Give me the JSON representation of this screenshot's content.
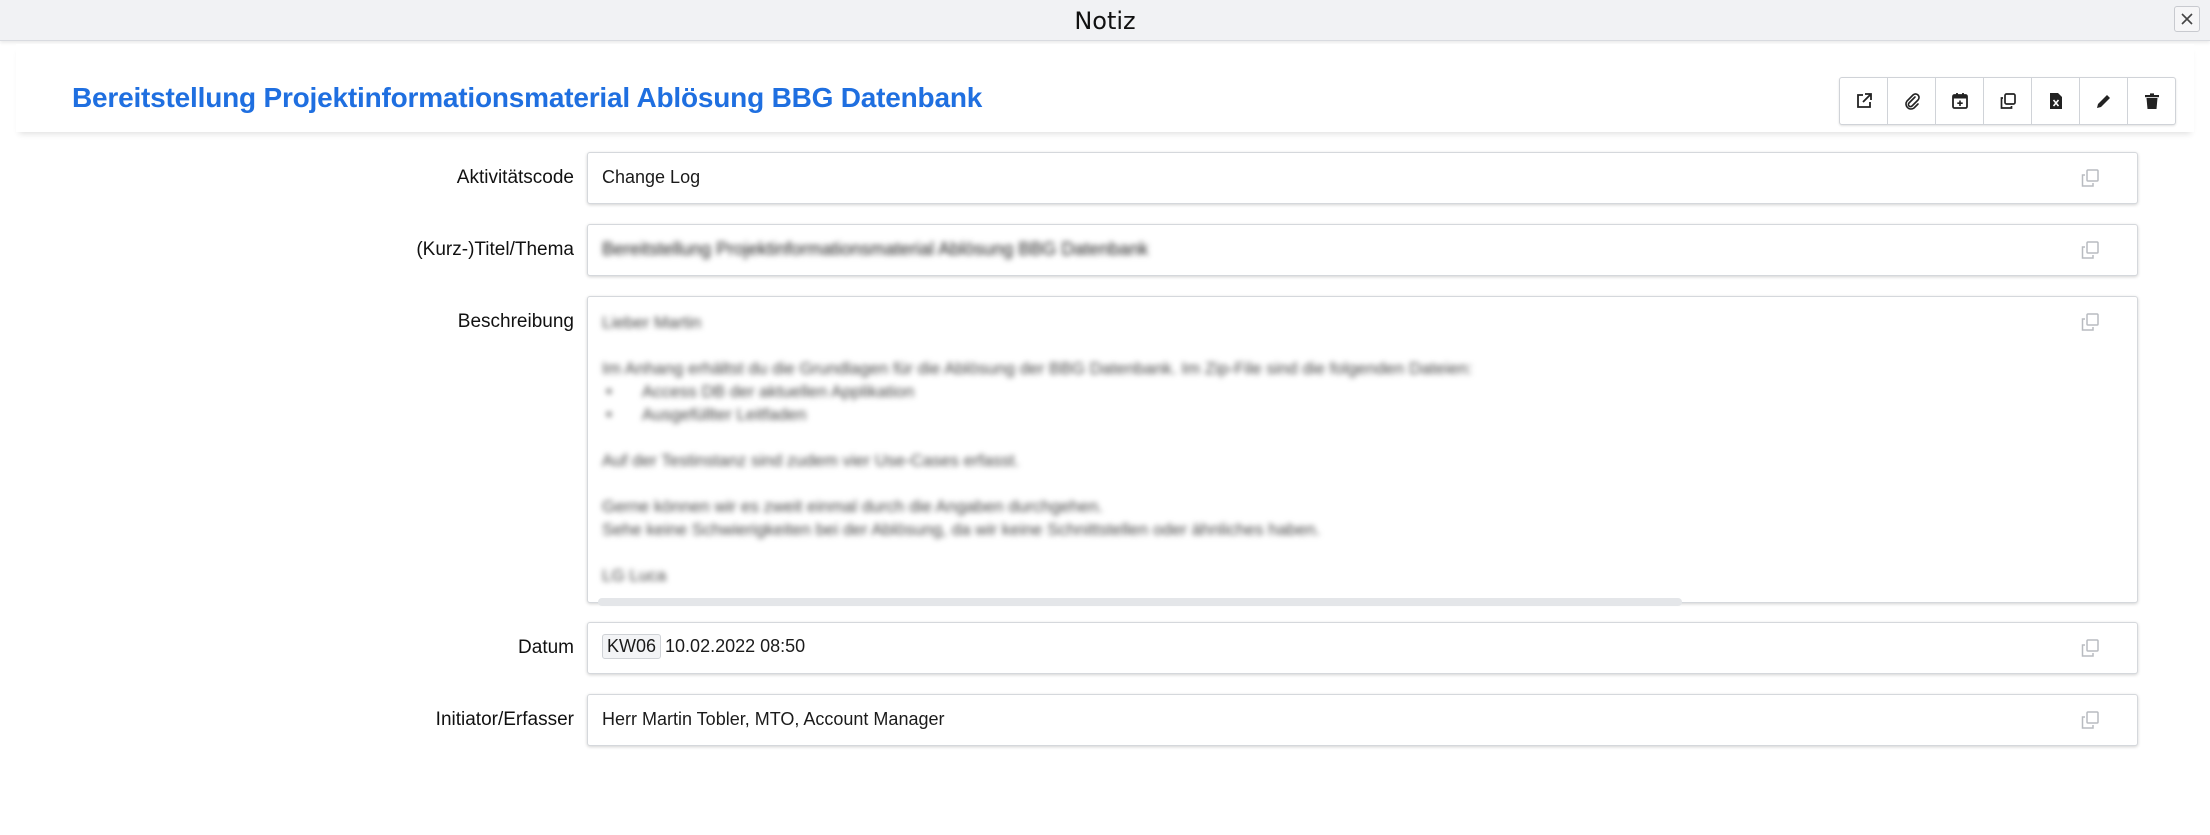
{
  "window": {
    "title": "Notiz"
  },
  "header": {
    "title": "Bereitstellung Projektinformationsmaterial Ablösung BBG Datenbank",
    "toolbar": [
      {
        "name": "open-external-button",
        "icon": "external-link-icon"
      },
      {
        "name": "attachment-button",
        "icon": "paperclip-icon"
      },
      {
        "name": "calendar-add-button",
        "icon": "calendar-plus-icon"
      },
      {
        "name": "duplicate-button",
        "icon": "copy-icon"
      },
      {
        "name": "export-button",
        "icon": "file-export-icon"
      },
      {
        "name": "edit-button",
        "icon": "pencil-icon"
      },
      {
        "name": "delete-button",
        "icon": "trash-icon"
      }
    ]
  },
  "fields": {
    "activity_code": {
      "label": "Aktivitätscode",
      "value": "Change Log"
    },
    "title": {
      "label": "(Kurz-)Titel/Thema",
      "value": "Bereitstellung Projektinformationsmaterial Ablösung BBG Datenbank"
    },
    "description": {
      "label": "Beschreibung",
      "greeting": "Lieber Martin",
      "intro": "Im Anhang erhältst du die Grundlagen für die Ablösung der BBG Datenbank. Im Zip-File sind die folgenden Dateien:",
      "bullet_1": "Access DB der aktuellen Applikation",
      "bullet_2": "Ausgefüllter Leitfaden",
      "line_4": "Auf der Testinstanz sind zudem vier Use-Cases erfasst.",
      "line_5": "Gerne können wir es zweit einmal durch die Angaben durchgehen.",
      "line_6": "Sehe keine Schwierigkeiten bei der Ablösung, da wir keine Schnittstellen oder ähnliches haben.",
      "signature": "LG Luca"
    },
    "date": {
      "label": "Datum",
      "week": "KW06",
      "value": "10.02.2022 08:50"
    },
    "initiator": {
      "label": "Initiator/Erfasser",
      "value": "Herr Martin Tobler, MTO, Account Manager"
    }
  },
  "colors": {
    "accent": "#1f6fe0"
  }
}
